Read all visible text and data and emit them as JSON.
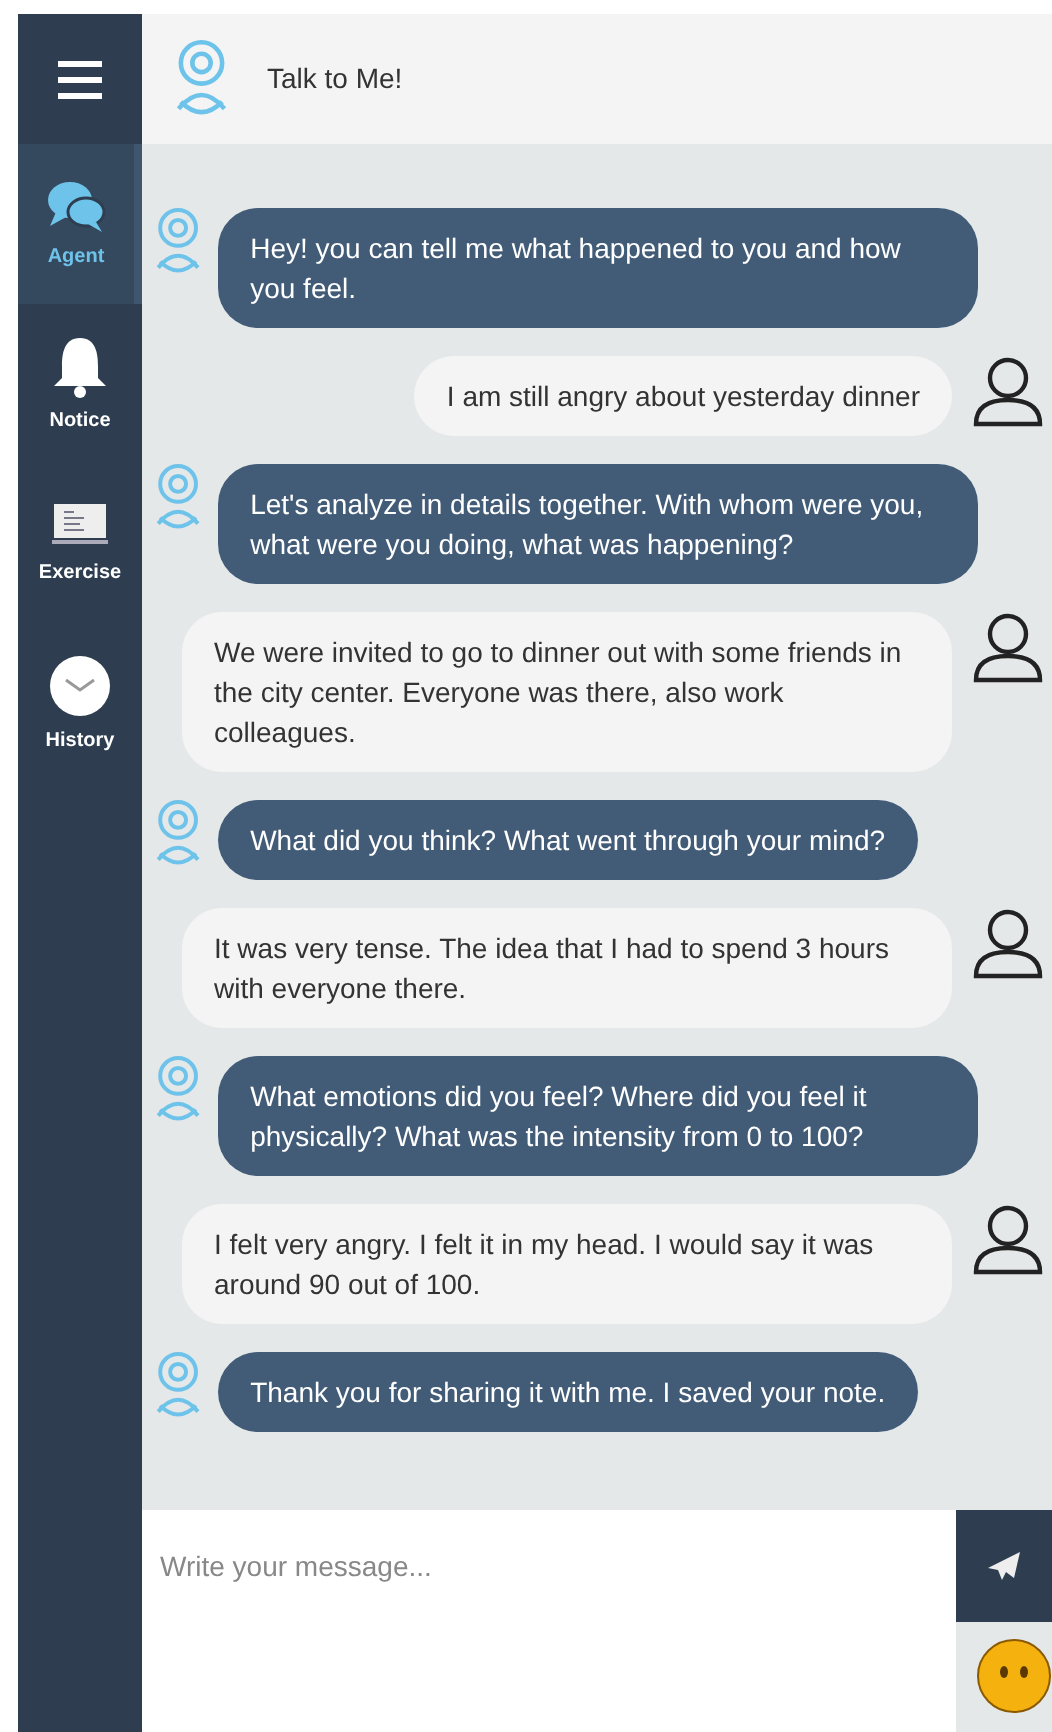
{
  "sidebar": {
    "items": [
      {
        "label": "Agent",
        "selected": true,
        "kind": "chat"
      },
      {
        "label": "Notice",
        "selected": false,
        "kind": "bell"
      },
      {
        "label": "Exercise",
        "selected": false,
        "kind": "screen"
      },
      {
        "label": "History",
        "selected": false,
        "kind": "clock"
      }
    ]
  },
  "header": {
    "title": "Talk to Me!"
  },
  "messages": [
    {
      "kind": "agent",
      "text": "Hey! you can tell me what happened to you and how you feel."
    },
    {
      "kind": "user",
      "text": "I am still angry about yesterday dinner"
    },
    {
      "kind": "agent",
      "text": "Let's analyze in details together. With whom were you, what were you doing, what was happening?"
    },
    {
      "kind": "user",
      "text": "We were invited to go to dinner out with some friends in the city center. Everyone was there, also work colleagues."
    },
    {
      "kind": "agent",
      "text": "What did you think? What went through your mind?"
    },
    {
      "kind": "user",
      "text": "It was very tense. The idea that I had to spend 3 hours with everyone there."
    },
    {
      "kind": "agent",
      "text": "What emotions did you feel? Where did you feel it physically? What was the intensity from 0 to 100?"
    },
    {
      "kind": "user",
      "text": "I felt very angry. I felt it in my head. I would say it was around 90 out of 100."
    },
    {
      "kind": "agent",
      "text": "Thank you for sharing it with me. I saved your note."
    }
  ],
  "composer": {
    "placeholder": "Write your message..."
  }
}
